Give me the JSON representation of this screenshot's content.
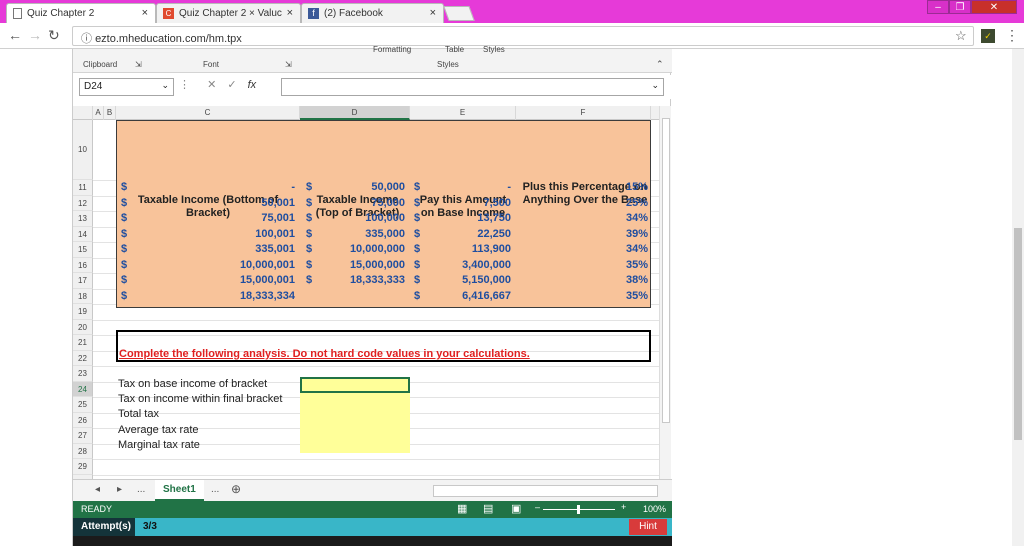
{
  "browser": {
    "tabs": [
      {
        "label": "Quiz Chapter 2",
        "active": true
      },
      {
        "label": "Quiz Chapter 2 × Valuc",
        "active": false
      },
      {
        "label": "(2) Facebook",
        "active": false
      }
    ],
    "tab_close": "×",
    "url": "ezto.mheducation.com/hm.tpx",
    "window_controls": [
      "minimize",
      "restore",
      "close"
    ]
  },
  "ribbon": {
    "groups": [
      "Clipboard",
      "Font",
      "Styles"
    ],
    "top_items": [
      "Formatting",
      "Table",
      "Styles"
    ]
  },
  "formula_bar": {
    "name_box": "D24",
    "fx": "fx",
    "value": ""
  },
  "columns": [
    "A",
    "B",
    "C",
    "D",
    "E",
    "F"
  ],
  "selected_column": "D",
  "rows": [
    "10",
    "11",
    "12",
    "13",
    "14",
    "15",
    "16",
    "17",
    "18",
    "19",
    "20",
    "21",
    "22",
    "23",
    "24",
    "25",
    "26",
    "27",
    "28",
    "29",
    "30"
  ],
  "selected_row": "24",
  "table": {
    "headers": {
      "c": "Taxable Income (Bottom of Bracket)",
      "d": "Taxable Income (Top of Bracket)",
      "e": "Pay this Amount on Base Income",
      "f": "Plus this Percentage on Anything Over the Base"
    },
    "currency": "$",
    "brackets": [
      {
        "bottom": "-",
        "top": "50,000",
        "base": "-",
        "pct": "15%"
      },
      {
        "bottom": "50,001",
        "top": "75,000",
        "base": "7,500",
        "pct": "25%"
      },
      {
        "bottom": "75,001",
        "top": "100,000",
        "base": "13,750",
        "pct": "34%"
      },
      {
        "bottom": "100,001",
        "top": "335,000",
        "base": "22,250",
        "pct": "39%"
      },
      {
        "bottom": "335,001",
        "top": "10,000,000",
        "base": "113,900",
        "pct": "34%"
      },
      {
        "bottom": "10,000,001",
        "top": "15,000,000",
        "base": "3,400,000",
        "pct": "35%"
      },
      {
        "bottom": "15,000,001",
        "top": "18,333,333",
        "base": "5,150,000",
        "pct": "38%"
      },
      {
        "bottom": "18,333,334",
        "top": "",
        "base": "6,416,667",
        "pct": "35%"
      }
    ]
  },
  "task": "Complete the following analysis. Do not hard code values in your calculations.",
  "analysis_labels": [
    "Tax on base income of bracket",
    "Tax on income within final bracket",
    "Total tax",
    "Average tax rate",
    "Marginal tax rate"
  ],
  "sheet_tab": "Sheet1",
  "sheet_more": "...",
  "status": {
    "ready": "READY",
    "zoom": "100%"
  },
  "attempts": {
    "label": "Attempt(s)",
    "value": "3/3",
    "hint": "Hint"
  }
}
